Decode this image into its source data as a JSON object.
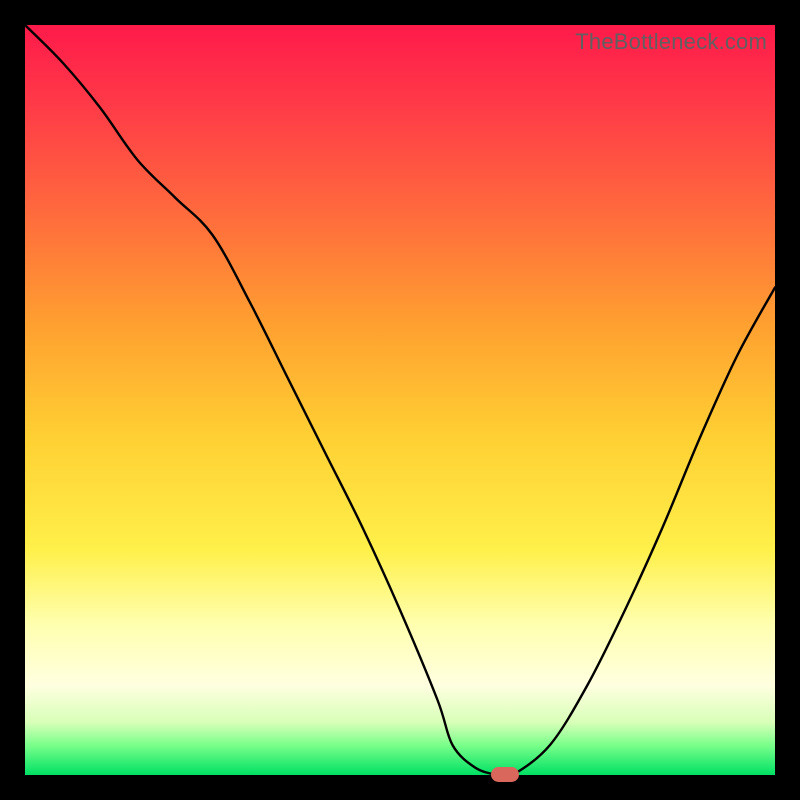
{
  "watermark": "TheBottleneck.com",
  "colors": {
    "frame": "#000000",
    "gradient_top": "#ff1a4a",
    "gradient_bottom": "#00e064",
    "curve": "#000000",
    "marker": "#d9675c"
  },
  "chart_data": {
    "type": "line",
    "title": "",
    "xlabel": "",
    "ylabel": "",
    "xlim": [
      0,
      100
    ],
    "ylim": [
      0,
      100
    ],
    "grid": false,
    "x": [
      0,
      5,
      10,
      15,
      20,
      25,
      30,
      35,
      40,
      45,
      50,
      55,
      57,
      60,
      63,
      65,
      70,
      75,
      80,
      85,
      90,
      95,
      100
    ],
    "values": [
      100,
      95,
      89,
      82,
      77,
      72,
      63,
      53,
      43,
      33,
      22,
      10,
      4,
      1,
      0,
      0,
      4,
      12,
      22,
      33,
      45,
      56,
      65
    ],
    "minimum_x": 64,
    "series_note": "single V-shaped bottleneck curve; minimum touches baseline near x≈64"
  },
  "marker": {
    "x_percent": 64,
    "y_percent": 0
  }
}
